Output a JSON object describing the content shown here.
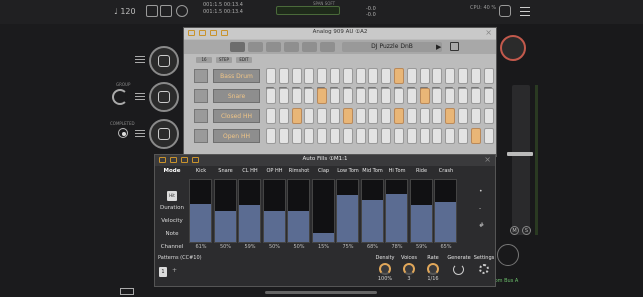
{
  "host": {
    "bpm": "♩ 120",
    "position_top": "001:1.5  00:13.4",
    "position_bottom": "001:1.5  00:13.4",
    "meter_label": "SPAN SOFT",
    "ab_top": "A",
    "ab_values": [
      "-0.0",
      "-0.0"
    ],
    "cpu": "CPU: 40 %",
    "left_labels": [
      "GROUP",
      "COMPLETED"
    ],
    "bus_text": "one from Bus A",
    "mute_label": "M",
    "solo_label": "S"
  },
  "analog909": {
    "title": "Analog 909 AU ①A2",
    "preset": "DJ Puzzle DnB",
    "mode_tabs": [
      "16",
      "STEP",
      "EDIT"
    ],
    "tracks": [
      {
        "name": "Bass Drum",
        "steps": [
          0,
          0,
          0,
          0,
          0,
          0,
          0,
          0,
          0,
          0,
          1,
          0,
          0,
          0,
          0,
          0,
          0,
          0
        ]
      },
      {
        "name": "Snare",
        "steps": [
          0,
          0,
          0,
          0,
          1,
          0,
          0,
          0,
          0,
          0,
          0,
          0,
          1,
          0,
          0,
          0,
          0,
          0
        ]
      },
      {
        "name": "Closed HH",
        "steps": [
          0,
          0,
          1,
          0,
          0,
          0,
          1,
          0,
          0,
          0,
          1,
          0,
          0,
          0,
          1,
          0,
          0,
          0
        ]
      },
      {
        "name": "Open HH",
        "steps": [
          0,
          0,
          0,
          0,
          0,
          0,
          0,
          0,
          0,
          0,
          0,
          0,
          0,
          0,
          0,
          0,
          1,
          0
        ]
      }
    ]
  },
  "autofills": {
    "title": "Auto Fills ①M1:1",
    "mode_header": "Mode",
    "mode_selected": "Hit",
    "mode_items": [
      "Duration",
      "Velocity",
      "Note",
      "Channel"
    ],
    "columns": [
      {
        "name": "Kick",
        "value": 61
      },
      {
        "name": "Snare",
        "value": 50
      },
      {
        "name": "CL HH",
        "value": 59
      },
      {
        "name": "OP HH",
        "value": 50
      },
      {
        "name": "Rimshot",
        "value": 50
      },
      {
        "name": "Clap",
        "value": 15
      },
      {
        "name": "Low Tom",
        "value": 75
      },
      {
        "name": "Mid Tom",
        "value": 68
      },
      {
        "name": "Hi Tom",
        "value": 78
      },
      {
        "name": "Ride",
        "value": 59
      },
      {
        "name": "Crash",
        "value": 65
      }
    ],
    "pct_labels": [
      "61%",
      "50%",
      "59%",
      "50%",
      "50%",
      "15%",
      "75%",
      "68%",
      "78%",
      "59%",
      "65%"
    ],
    "patterns_label": "Patterns (CC#10)",
    "pattern_value": "1",
    "controls": [
      {
        "label": "Density",
        "value": "100%"
      },
      {
        "label": "Voices",
        "value": "3"
      },
      {
        "label": "Rate",
        "value": "1/16"
      }
    ],
    "generate_label": "Generate",
    "settings_label": "Settings",
    "side_symbols": [
      "•",
      "-",
      "#"
    ]
  }
}
